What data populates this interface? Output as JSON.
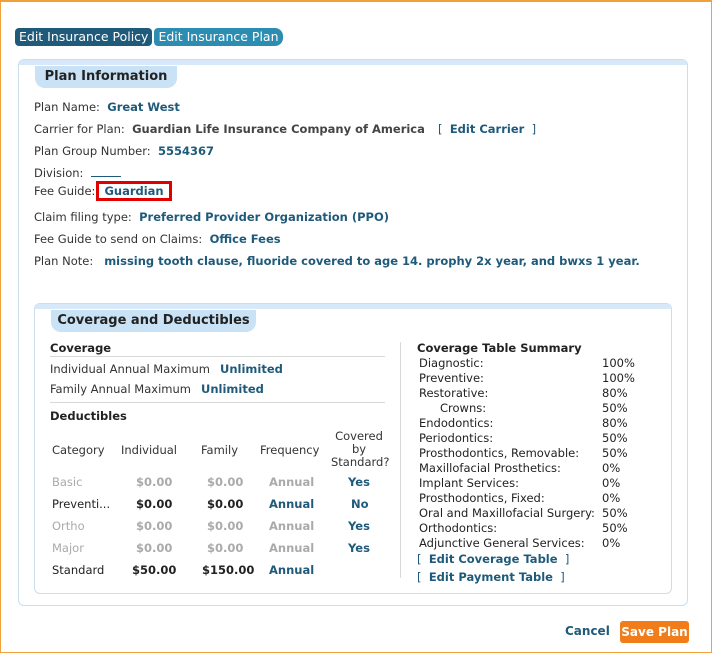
{
  "tabs": {
    "edit_policy": "Edit Insurance Policy",
    "edit_plan": "Edit Insurance Plan"
  },
  "plan_info": {
    "title": "Plan Information",
    "plan_name_label": "Plan Name:",
    "plan_name": "Great West",
    "carrier_label": "Carrier for Plan:",
    "carrier": "Guardian Life Insurance Company of America",
    "edit_carrier": "Edit Carrier",
    "group_label": "Plan Group Number:",
    "group": "5554367",
    "division_label": "Division:",
    "fee_guide_label": "Fee Guide:",
    "fee_guide": "Guardian",
    "claim_label": "Claim filing type:",
    "claim": "Preferred Provider Organization (PPO)",
    "fee_claims_label": "Fee Guide to send on Claims:",
    "fee_claims": "Office Fees",
    "note_label": "Plan Note:",
    "note": "missing tooth clause, fluoride covered to age 14. prophy 2x year, and bwxs 1 year."
  },
  "coverage": {
    "title": "Coverage and Deductibles",
    "coverage_header": "Coverage",
    "ind_max_label": "Individual Annual Maximum",
    "ind_max": "Unlimited",
    "fam_max_label": "Family Annual Maximum",
    "fam_max": "Unlimited",
    "deductibles_header": "Deductibles",
    "columns": {
      "category": "Category",
      "individual": "Individual",
      "family": "Family",
      "frequency": "Frequency",
      "covered1": "Covered",
      "covered2": "by",
      "covered3": "Standard?"
    },
    "rows": [
      {
        "category": "Basic",
        "individual": "$0.00",
        "family": "$0.00",
        "frequency": "Annual",
        "covered": "Yes"
      },
      {
        "category": "Preventi...",
        "individual": "$0.00",
        "family": "$0.00",
        "frequency": "Annual",
        "covered": "No"
      },
      {
        "category": "Ortho",
        "individual": "$0.00",
        "family": "$0.00",
        "frequency": "Annual",
        "covered": "Yes"
      },
      {
        "category": "Major",
        "individual": "$0.00",
        "family": "$0.00",
        "frequency": "Annual",
        "covered": "Yes"
      },
      {
        "category": "Standard",
        "individual": "$50.00",
        "family": "$150.00",
        "frequency": "Annual",
        "covered": ""
      }
    ],
    "summary_header": "Coverage Table Summary",
    "summary": [
      {
        "label": "Diagnostic:",
        "pct": "100%"
      },
      {
        "label": "Preventive:",
        "pct": "100%"
      },
      {
        "label": "Restorative:",
        "pct": "80%"
      },
      {
        "label": "Crowns:",
        "pct": "50%"
      },
      {
        "label": "Endodontics:",
        "pct": "80%"
      },
      {
        "label": "Periodontics:",
        "pct": "50%"
      },
      {
        "label": "Prosthodontics, Removable:",
        "pct": "50%"
      },
      {
        "label": "Maxillofacial Prosthetics:",
        "pct": "0%"
      },
      {
        "label": "Implant Services:",
        "pct": "0%"
      },
      {
        "label": "Prosthodontics, Fixed:",
        "pct": "0%"
      },
      {
        "label": "Oral and Maxillofacial Surgery:",
        "pct": "50%"
      },
      {
        "label": "Orthodontics:",
        "pct": "50%"
      },
      {
        "label": "Adjunctive General Services:",
        "pct": "0%"
      }
    ],
    "edit_coverage": "Edit Coverage Table",
    "edit_payment": "Edit Payment Table"
  },
  "footer": {
    "cancel": "Cancel",
    "save": "Save Plan"
  },
  "colors": {
    "accent": "#1f5a7a",
    "save": "#f07d1a",
    "highlight": "#e00000"
  }
}
